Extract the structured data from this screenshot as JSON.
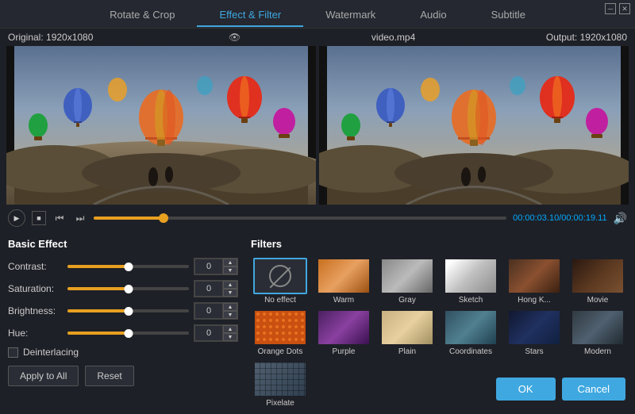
{
  "window": {
    "minimize_label": "─",
    "close_label": "✕"
  },
  "tabs": [
    {
      "id": "rotate-crop",
      "label": "Rotate & Crop",
      "active": false
    },
    {
      "id": "effect-filter",
      "label": "Effect & Filter",
      "active": true
    },
    {
      "id": "watermark",
      "label": "Watermark",
      "active": false
    },
    {
      "id": "audio",
      "label": "Audio",
      "active": false
    },
    {
      "id": "subtitle",
      "label": "Subtitle",
      "active": false
    }
  ],
  "video_info": {
    "original": "Original: 1920x1080",
    "filename": "video.mp4",
    "output": "Output: 1920x1080"
  },
  "playback": {
    "progress_percent": 17,
    "time_current": "00:00:03.10",
    "time_total": "00:00:19.11",
    "time_separator": "/"
  },
  "basic_effect": {
    "title": "Basic Effect",
    "contrast_label": "Contrast:",
    "contrast_value": "0",
    "saturation_label": "Saturation:",
    "saturation_value": "0",
    "brightness_label": "Brightness:",
    "brightness_value": "0",
    "hue_label": "Hue:",
    "hue_value": "0",
    "deinterlacing_label": "Deinterlacing",
    "apply_label": "Apply to All",
    "reset_label": "Reset"
  },
  "filters": {
    "title": "Filters",
    "items": [
      {
        "id": "no-effect",
        "label": "No effect",
        "selected": true
      },
      {
        "id": "warm",
        "label": "Warm",
        "selected": false
      },
      {
        "id": "gray",
        "label": "Gray",
        "selected": false
      },
      {
        "id": "sketch",
        "label": "Sketch",
        "selected": false
      },
      {
        "id": "hong-k",
        "label": "Hong K...",
        "selected": false
      },
      {
        "id": "movie",
        "label": "Movie",
        "selected": false
      },
      {
        "id": "orange-dots",
        "label": "Orange Dots",
        "selected": false
      },
      {
        "id": "purple",
        "label": "Purple",
        "selected": false
      },
      {
        "id": "plain",
        "label": "Plain",
        "selected": false
      },
      {
        "id": "coordinates",
        "label": "Coordinates",
        "selected": false
      },
      {
        "id": "stars",
        "label": "Stars",
        "selected": false
      },
      {
        "id": "modern",
        "label": "Modern",
        "selected": false
      },
      {
        "id": "pixelate",
        "label": "Pixelate",
        "selected": false
      }
    ]
  },
  "footer": {
    "ok_label": "OK",
    "cancel_label": "Cancel"
  }
}
